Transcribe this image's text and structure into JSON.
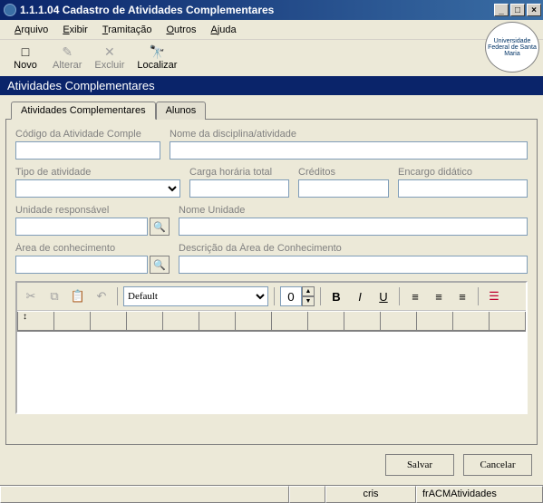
{
  "window": {
    "title": "1.1.1.04 Cadastro de Atividades Complementares"
  },
  "menu": {
    "arquivo": "Arquivo",
    "exibir": "Exibir",
    "tramitacao": "Tramitação",
    "outros": "Outros",
    "ajuda": "Ajuda"
  },
  "toolbar": {
    "novo": "Novo",
    "alterar": "Alterar",
    "excluir": "Excluir",
    "localizar": "Localizar"
  },
  "band": {
    "title": "Atividades Complementares"
  },
  "tabs": {
    "tab1": "Atividades Complementares",
    "tab2": "Alunos"
  },
  "fields": {
    "codigo_label": "Código da Atividade Comple",
    "codigo_value": "",
    "nome_disc_label": "Nome da disciplina/atividade",
    "nome_disc_value": "",
    "tipo_label": "Tipo de atividade",
    "tipo_value": "",
    "carga_label": "Carga horária total",
    "carga_value": "",
    "creditos_label": "Créditos",
    "creditos_value": "",
    "encargo_label": "Encargo didático",
    "encargo_value": "",
    "unidade_resp_label": "Unidade responsável",
    "unidade_resp_value": "",
    "nome_unidade_label": "Nome Unidade",
    "nome_unidade_value": "",
    "area_con_label": "Área de conhecimento",
    "area_con_value": "",
    "desc_area_label": "Descrição da Área de Conhecimento",
    "desc_area_value": ""
  },
  "editor": {
    "font_name": "Default",
    "font_size": "0"
  },
  "buttons": {
    "salvar": "Salvar",
    "cancelar": "Cancelar"
  },
  "status": {
    "user": "cris",
    "form": "frACMAtividades"
  },
  "icons": {
    "novo": "□",
    "alterar": "✎",
    "excluir": "✕",
    "localizar": "🔭",
    "search": "🔍",
    "cut": "✂",
    "copy": "⧉",
    "paste": "📋",
    "undo": "↶",
    "bold": "B",
    "italic": "I",
    "underline": "U",
    "align_left": "≡",
    "align_center": "≡",
    "align_right": "≡",
    "bullets": "☰"
  }
}
